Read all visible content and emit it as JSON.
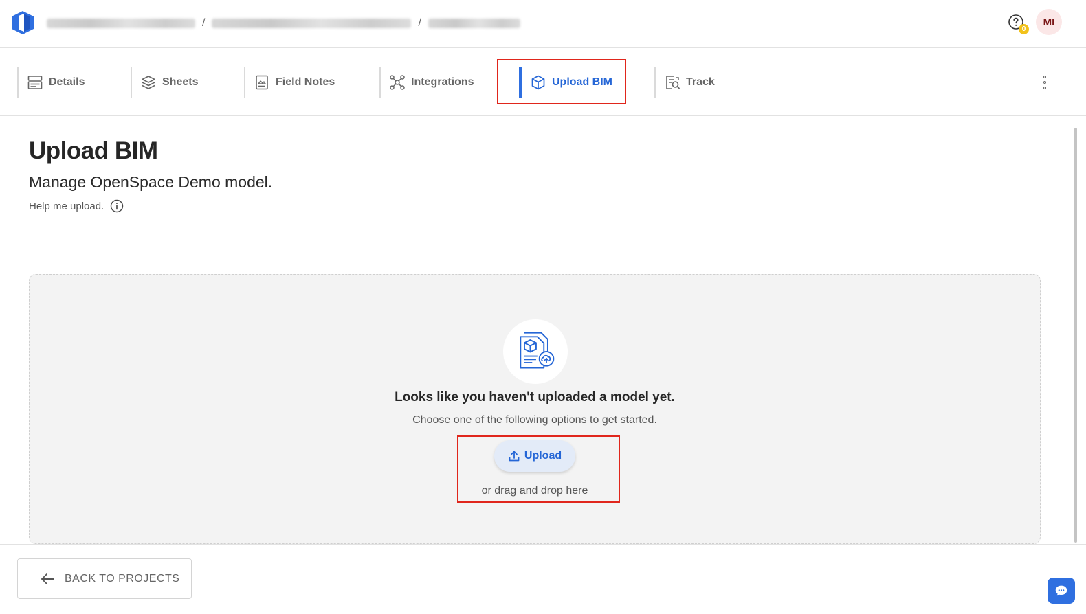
{
  "header": {
    "help_badge_count": "0",
    "avatar_initials": "MI"
  },
  "tabs": [
    {
      "label": "Details",
      "icon": "details-icon",
      "active": false
    },
    {
      "label": "Sheets",
      "icon": "layers-icon",
      "active": false
    },
    {
      "label": "Field Notes",
      "icon": "field-notes-icon",
      "active": false
    },
    {
      "label": "Integrations",
      "icon": "integrations-icon",
      "active": false
    },
    {
      "label": "Upload BIM",
      "icon": "cube-icon",
      "active": true
    },
    {
      "label": "Track",
      "icon": "track-icon",
      "active": false
    }
  ],
  "main": {
    "title": "Upload BIM",
    "subtitle": "Manage OpenSpace Demo model.",
    "help_link": "Help me upload."
  },
  "dropzone": {
    "title": "Looks like you haven't uploaded a model yet.",
    "subtitle": "Choose one of the following options to get started.",
    "upload_label": "Upload",
    "drag_text": "or drag and drop here"
  },
  "footer": {
    "back_label": "BACK TO PROJECTS"
  },
  "colors": {
    "accent": "#2566d6",
    "highlight": "#e0261c",
    "badge": "#f2c21b"
  }
}
